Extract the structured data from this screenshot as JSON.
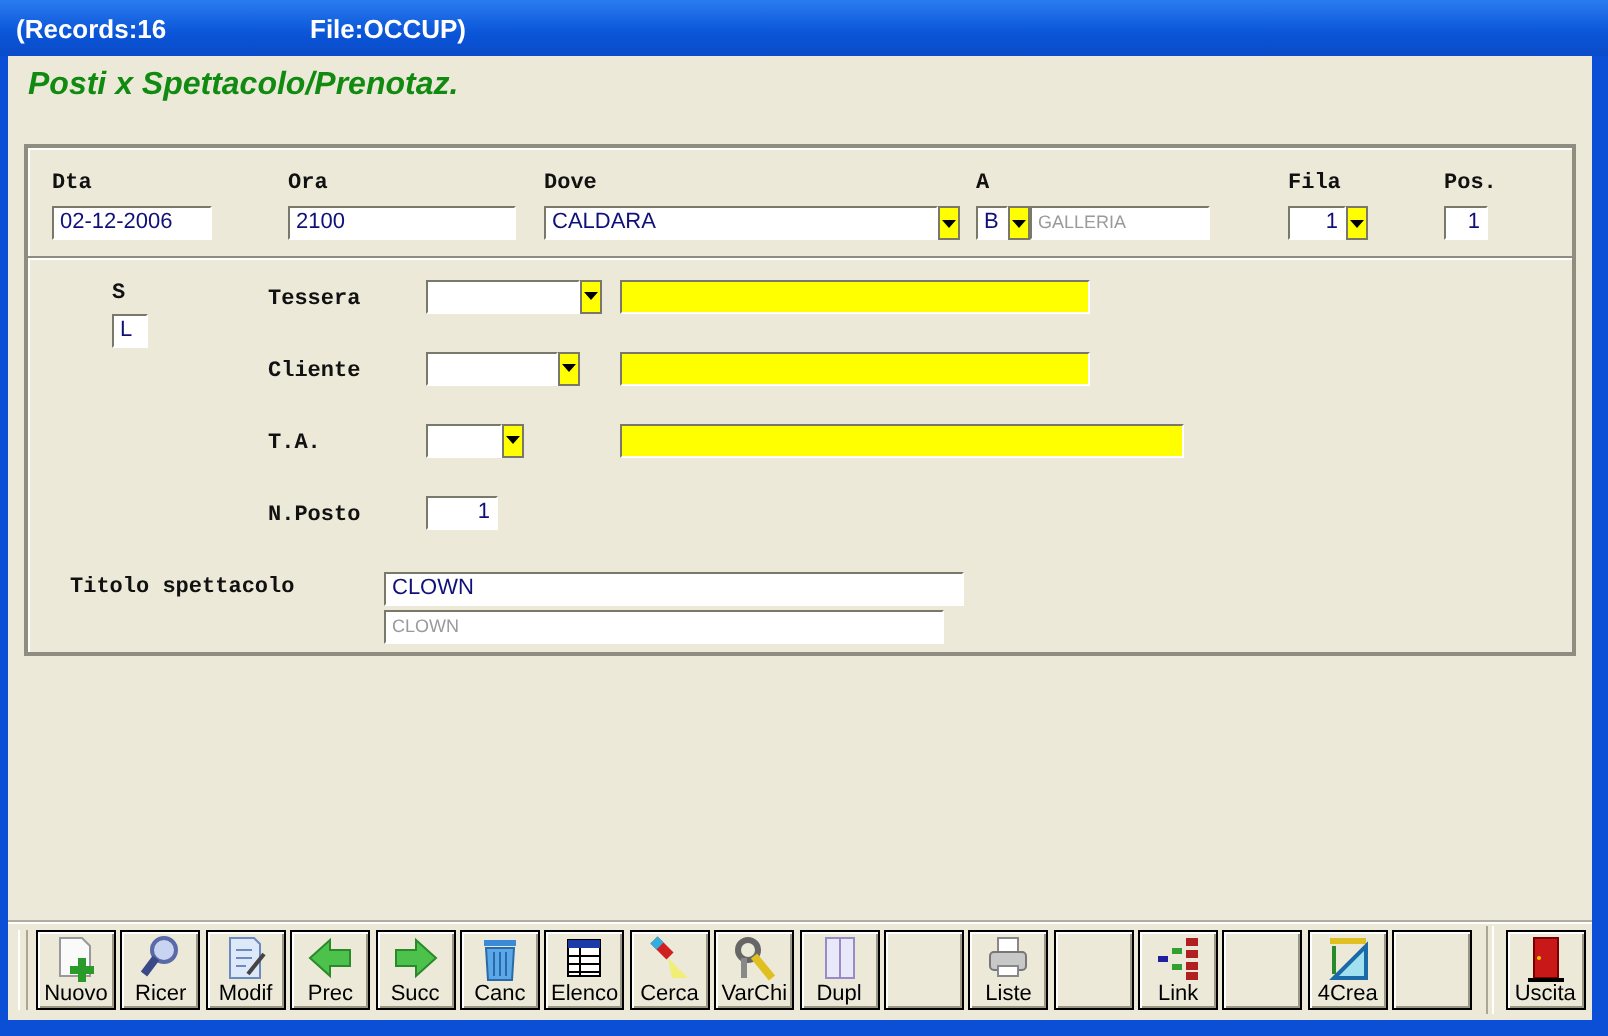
{
  "window": {
    "title": [
      "(Records:16",
      "File:OCCUP)"
    ]
  },
  "heading": "Posti x Spettacolo/Prenotaz.",
  "header_fields": [
    {
      "label": "Dta",
      "value": "02-12-2006",
      "kind": "text"
    },
    {
      "label": "Ora",
      "value": "2100",
      "kind": "text"
    },
    {
      "label": "Dove",
      "value": "CALDARA",
      "kind": "combo"
    },
    {
      "label": "A",
      "value": "B",
      "kind": "combo",
      "description": "GALLERIA"
    },
    {
      "label": "Fila",
      "value": "1",
      "kind": "combo"
    },
    {
      "label": "Pos.",
      "value": "1",
      "kind": "number"
    }
  ],
  "s_field": {
    "label": "S",
    "value": "L"
  },
  "detail_rows": [
    {
      "label": "Tessera",
      "kind": "lookup"
    },
    {
      "label": "Cliente",
      "kind": "lookup"
    },
    {
      "label": "T.A.",
      "kind": "lookup"
    },
    {
      "label": "N.Posto",
      "value": "1",
      "kind": "number"
    }
  ],
  "title_field": {
    "label": "Titolo spettacolo",
    "value": "CLOWN",
    "echo": "CLOWN"
  },
  "toolbar": [
    {
      "label": "Nuovo",
      "kind": "new"
    },
    {
      "label": "Ricer",
      "kind": "search"
    },
    {
      "label": "Modif",
      "kind": "edit"
    },
    {
      "label": "Prec",
      "kind": "prev"
    },
    {
      "label": "Succ",
      "kind": "next"
    },
    {
      "label": "Canc",
      "kind": "delete"
    },
    {
      "label": "Elenco",
      "kind": "table"
    },
    {
      "label": "Cerca",
      "kind": "torch"
    },
    {
      "label": "VarChi",
      "kind": "keys"
    },
    {
      "label": "Dupl",
      "kind": "copy"
    },
    {
      "kind": "blank"
    },
    {
      "label": "Liste",
      "kind": "print"
    },
    {
      "kind": "blank"
    },
    {
      "label": "Link",
      "kind": "link"
    },
    {
      "kind": "blank"
    },
    {
      "label": "4Crea",
      "kind": "ruler"
    },
    {
      "kind": "blank"
    },
    {
      "label": "Uscita",
      "kind": "exit"
    }
  ]
}
